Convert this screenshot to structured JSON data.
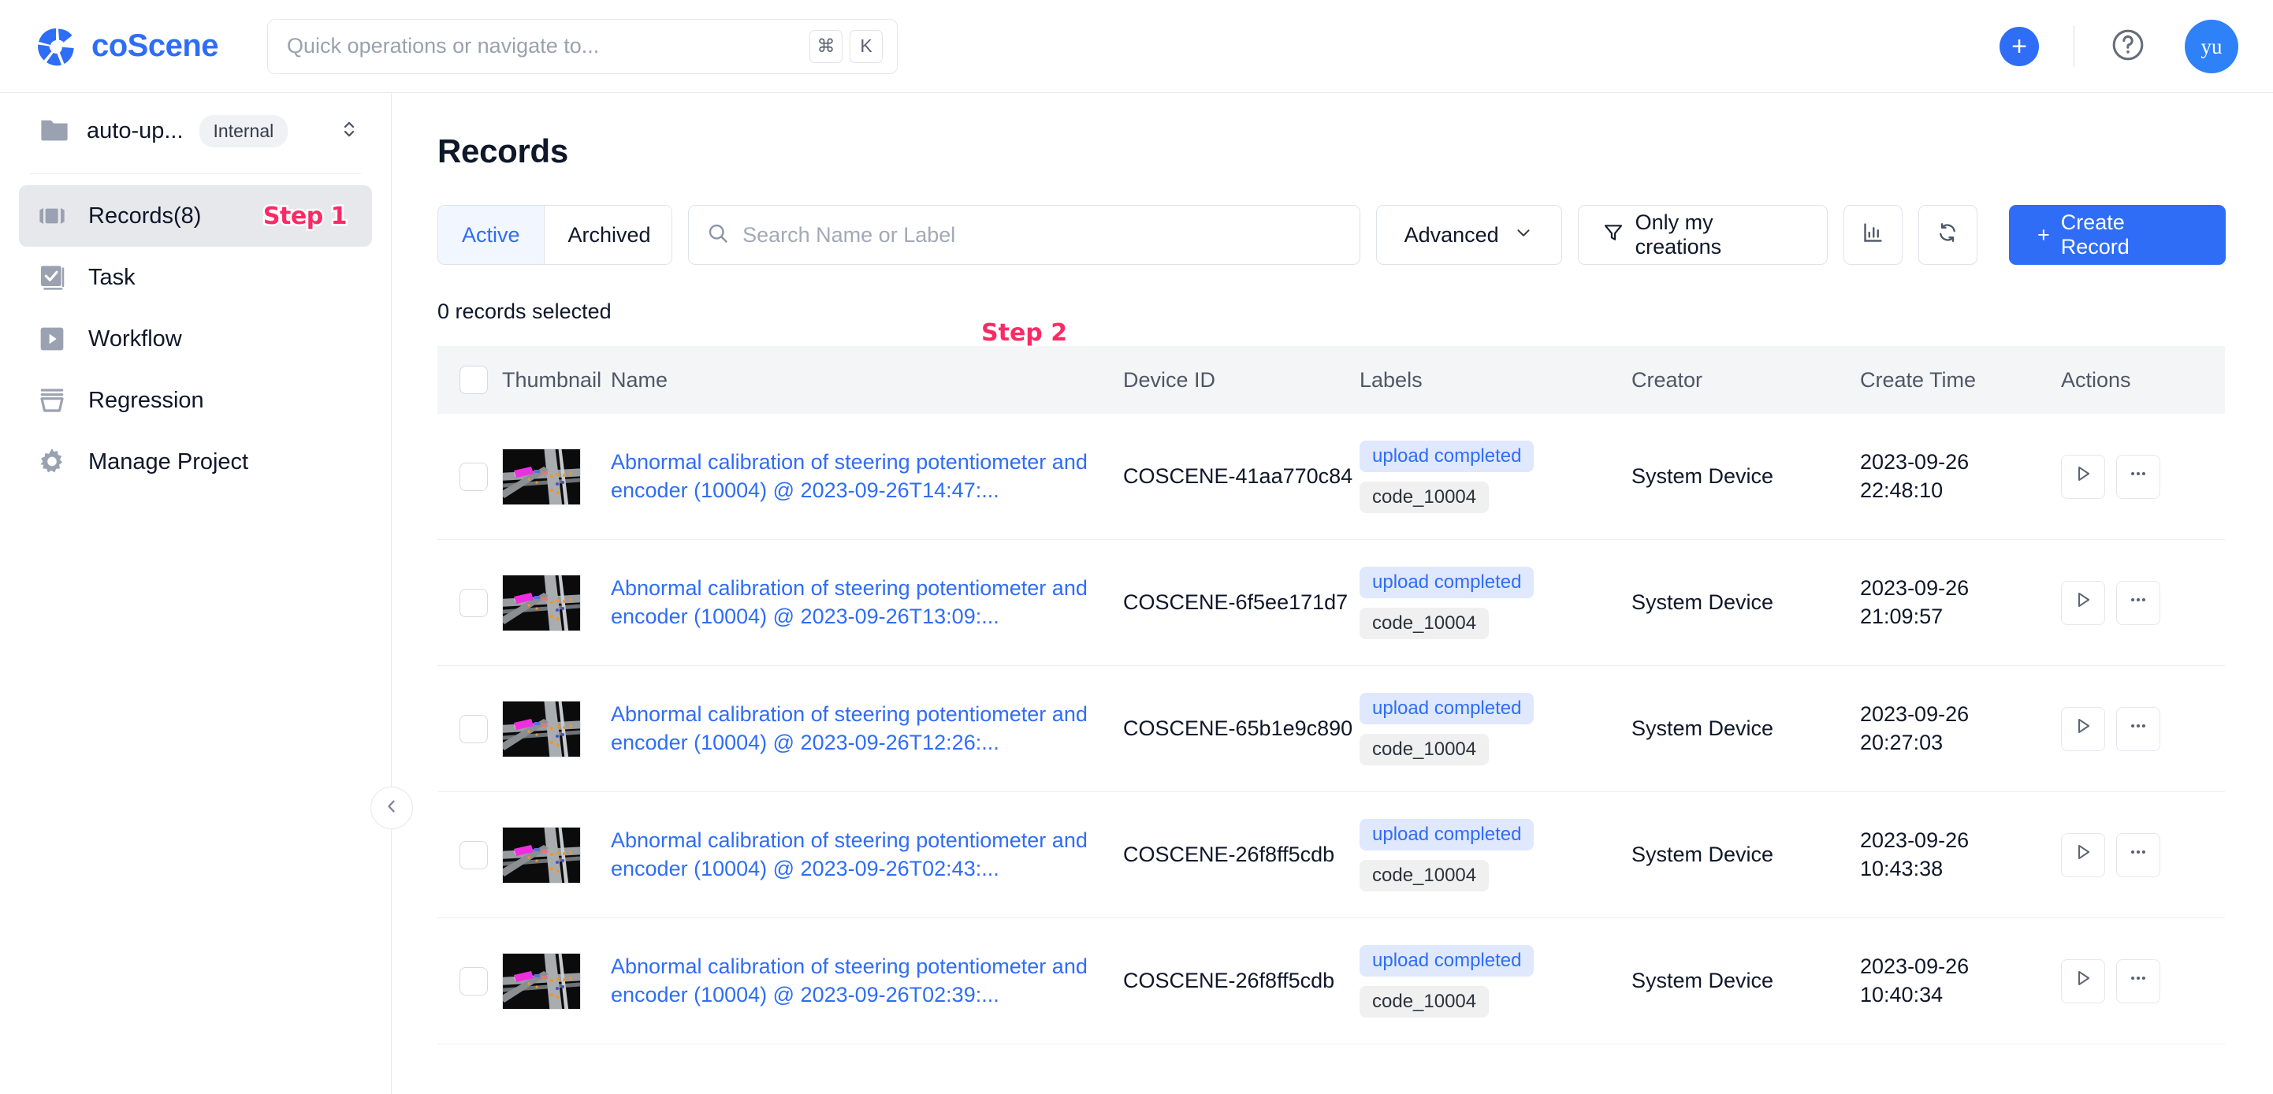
{
  "header": {
    "brand_name": "coScene",
    "brand_logo_icon": "coscene-logo-icon",
    "search": {
      "placeholder": "Quick operations or navigate to...",
      "kbd_modifier": "⌘",
      "kbd_key": "K"
    },
    "create_icon": "plus-icon",
    "help_icon": "question-circle-icon",
    "avatar_initials": "yu"
  },
  "sidebar": {
    "project": {
      "folder_icon": "folder-icon",
      "name": "auto-up...",
      "visibility_chip": "Internal",
      "switch_icon": "chevron-up-down-icon"
    },
    "items": [
      {
        "label": "Records(8)",
        "icon": "records-icon",
        "active": true,
        "step": "Step 1"
      },
      {
        "label": "Task",
        "icon": "task-checkbox-icon",
        "active": false,
        "step": ""
      },
      {
        "label": "Workflow",
        "icon": "workflow-play-icon",
        "active": false,
        "step": ""
      },
      {
        "label": "Regression",
        "icon": "regression-funnel-icon",
        "active": false,
        "step": ""
      },
      {
        "label": "Manage Project",
        "icon": "gear-icon",
        "active": false,
        "step": ""
      }
    ],
    "collapse_icon": "chevron-left-icon"
  },
  "main": {
    "title": "Records",
    "tabs": [
      {
        "label": "Active",
        "active": true
      },
      {
        "label": "Archived",
        "active": false
      }
    ],
    "search": {
      "placeholder": "Search Name or Label",
      "value": "",
      "icon": "search-icon"
    },
    "advanced_button": {
      "label": "Advanced",
      "icon": "chevron-down-icon"
    },
    "only_my_creations_button": {
      "label": "Only my creations",
      "icon": "filter-funnel-icon"
    },
    "chart_button_icon": "bar-chart-icon",
    "refresh_button_icon": "refresh-icon",
    "create_record_button": {
      "label": "Create Record",
      "icon": "plus-icon"
    },
    "selection_status": "0 records selected",
    "step_annotation": "Step 2",
    "table": {
      "columns": [
        "Thumbnail",
        "Name",
        "Device ID",
        "Labels",
        "Creator",
        "Create Time",
        "Actions"
      ],
      "rows": [
        {
          "name": "Abnormal calibration of steering potentiometer and encoder (10004) @ 2023-09-26T14:47:...",
          "device_id": "COSCENE-41aa770c84",
          "labels": [
            "upload completed",
            "code_10004"
          ],
          "creator": "System Device",
          "create_date": "2023-09-26",
          "create_time": "22:48:10",
          "thumbnail_icon": "intersection-pointcloud-thumbnail",
          "play_icon": "play-icon",
          "more_icon": "more-horizontal-icon"
        },
        {
          "name": "Abnormal calibration of steering potentiometer and encoder (10004) @ 2023-09-26T13:09:...",
          "device_id": "COSCENE-6f5ee171d7",
          "labels": [
            "upload completed",
            "code_10004"
          ],
          "creator": "System Device",
          "create_date": "2023-09-26",
          "create_time": "21:09:57",
          "thumbnail_icon": "intersection-pointcloud-thumbnail",
          "play_icon": "play-icon",
          "more_icon": "more-horizontal-icon"
        },
        {
          "name": "Abnormal calibration of steering potentiometer and encoder (10004) @ 2023-09-26T12:26:...",
          "device_id": "COSCENE-65b1e9c890",
          "labels": [
            "upload completed",
            "code_10004"
          ],
          "creator": "System Device",
          "create_date": "2023-09-26",
          "create_time": "20:27:03",
          "thumbnail_icon": "intersection-pointcloud-thumbnail",
          "play_icon": "play-icon",
          "more_icon": "more-horizontal-icon"
        },
        {
          "name": "Abnormal calibration of steering potentiometer and encoder (10004) @ 2023-09-26T02:43:...",
          "device_id": "COSCENE-26f8ff5cdb",
          "labels": [
            "upload completed",
            "code_10004"
          ],
          "creator": "System Device",
          "create_date": "2023-09-26",
          "create_time": "10:43:38",
          "thumbnail_icon": "intersection-pointcloud-thumbnail",
          "play_icon": "play-icon",
          "more_icon": "more-horizontal-icon"
        },
        {
          "name": "Abnormal calibration of steering potentiometer and encoder (10004) @ 2023-09-26T02:39:...",
          "device_id": "COSCENE-26f8ff5cdb",
          "labels": [
            "upload completed",
            "code_10004"
          ],
          "creator": "System Device",
          "create_date": "2023-09-26",
          "create_time": "10:40:34",
          "thumbnail_icon": "intersection-pointcloud-thumbnail",
          "play_icon": "play-icon",
          "more_icon": "more-horizontal-icon"
        }
      ]
    }
  },
  "colors": {
    "brand_blue": "#2f6df6",
    "accent_pink": "#fb2a65",
    "tag_blue_bg": "#dfe8fd",
    "tag_gray_bg": "#f0f0f0",
    "header_row_bg": "#f4f5f7",
    "sidebar_active_bg": "#e6e8ec"
  }
}
